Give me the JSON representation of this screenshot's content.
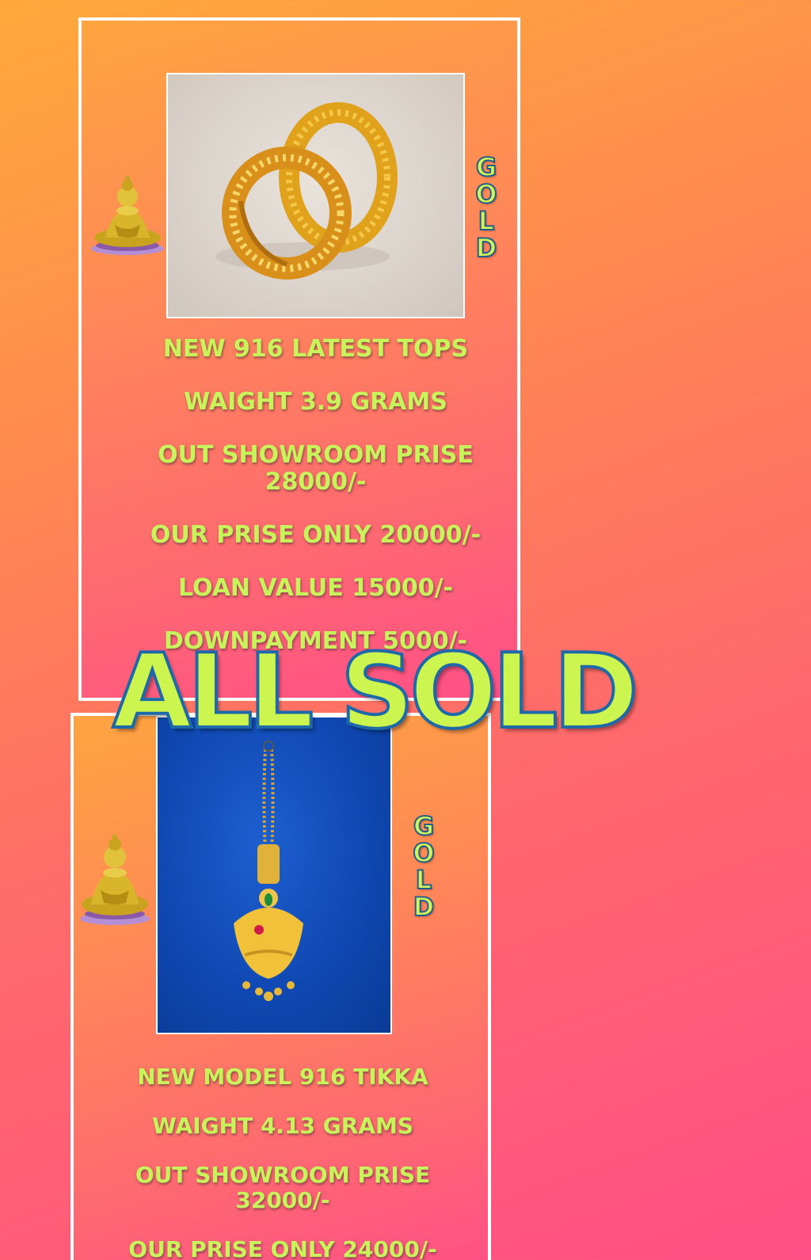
{
  "overlay_text": "ALL SOLD",
  "colors": {
    "text_green": "#c9f35a",
    "stroke_blue": "#1e6aa8",
    "background_start": "#ffa93a",
    "background_end": "#ff4f86",
    "card_border": "#ffffff"
  },
  "products": [
    {
      "badge": "GOLD",
      "image": "gold-hoop-earrings-photo",
      "decoration": "buddha-statue-icon",
      "title": "NEW 916 LATEST TOPS",
      "weight": "WAIGHT 3.9 GRAMS",
      "showroom_price": "OUT SHOWROOM PRISE 28000/-",
      "our_price": "OUR PRISE ONLY 20000/-",
      "loan_value": "LOAN VALUE 15000/-",
      "downpayment": "DOWNPAYMENT 5000/-"
    },
    {
      "badge": "GOLD",
      "image": "gold-tikka-photo",
      "decoration": "buddha-statue-icon",
      "title": "NEW MODEL 916 TIKKA",
      "weight": "WAIGHT 4.13 GRAMS",
      "showroom_price": "OUT SHOWROOM PRISE 32000/-",
      "our_price": "OUR PRISE ONLY 24000/-"
    }
  ]
}
